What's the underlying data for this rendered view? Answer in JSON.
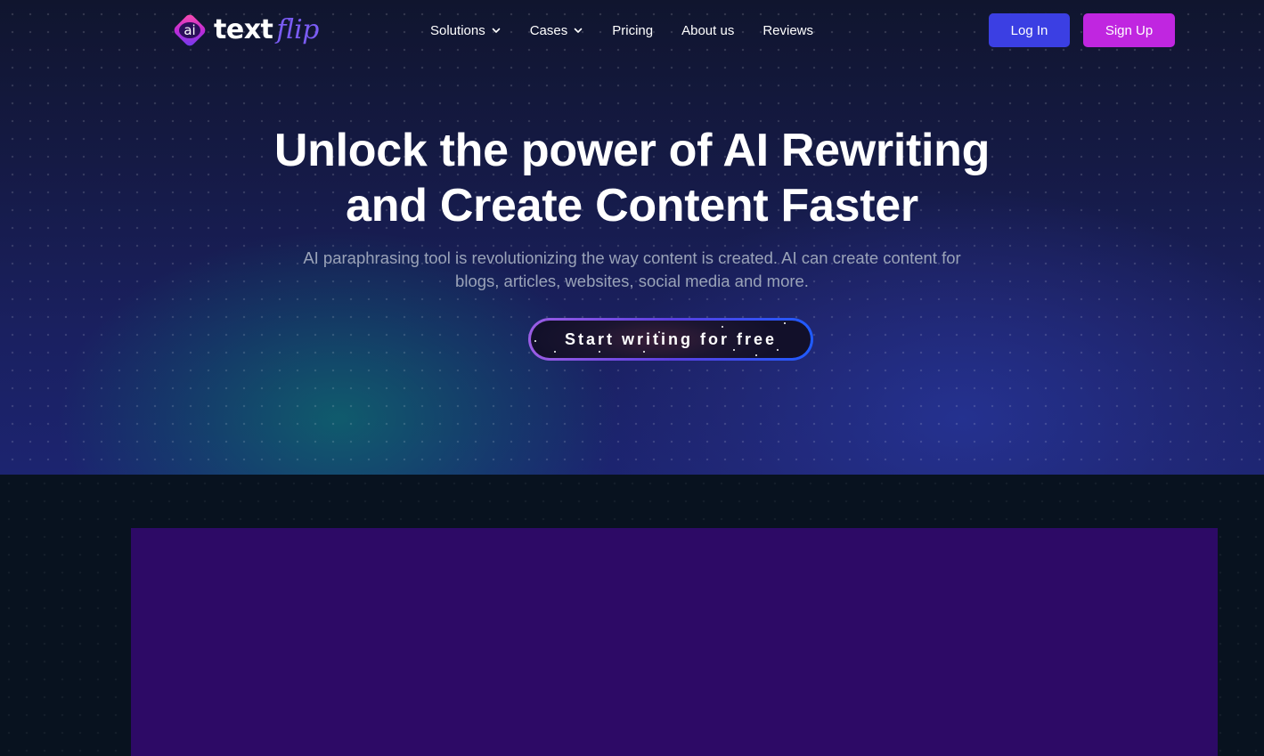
{
  "brand": {
    "logo_badge": "ai",
    "name_primary": "text",
    "name_accent": "flip"
  },
  "nav": {
    "items": [
      {
        "label": "Solutions",
        "has_dropdown": true
      },
      {
        "label": "Cases",
        "has_dropdown": true
      },
      {
        "label": "Pricing",
        "has_dropdown": false
      },
      {
        "label": "About us",
        "has_dropdown": false
      },
      {
        "label": "Reviews",
        "has_dropdown": false
      }
    ],
    "login_label": "Log In",
    "signup_label": "Sign Up"
  },
  "hero": {
    "title_line1": "Unlock the power of AI Rewriting",
    "title_line2": "and Create Content Faster",
    "subtitle_line1": "AI paraphrasing tool is revolutionizing the way content is created. AI can create content for",
    "subtitle_line2": "blogs, articles, websites, social media and more.",
    "cta_label": "Start writing for free"
  },
  "colors": {
    "login_button": "#3b3fe3",
    "signup_button": "#c026e0",
    "video_panel": "#2d0a66",
    "logo_accent": "#7b5cf5"
  },
  "icons": {
    "logo": "textflip-diamond-logo",
    "dropdown": "chevron-down-icon"
  }
}
